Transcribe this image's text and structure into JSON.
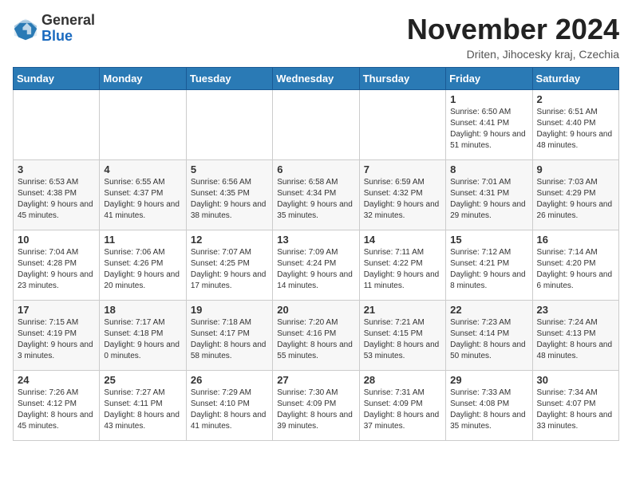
{
  "logo": {
    "line1": "General",
    "line2": "Blue"
  },
  "title": "November 2024",
  "subtitle": "Driten, Jihocesky kraj, Czechia",
  "days_of_week": [
    "Sunday",
    "Monday",
    "Tuesday",
    "Wednesday",
    "Thursday",
    "Friday",
    "Saturday"
  ],
  "weeks": [
    [
      {
        "day": "",
        "info": ""
      },
      {
        "day": "",
        "info": ""
      },
      {
        "day": "",
        "info": ""
      },
      {
        "day": "",
        "info": ""
      },
      {
        "day": "",
        "info": ""
      },
      {
        "day": "1",
        "info": "Sunrise: 6:50 AM\nSunset: 4:41 PM\nDaylight: 9 hours and 51 minutes."
      },
      {
        "day": "2",
        "info": "Sunrise: 6:51 AM\nSunset: 4:40 PM\nDaylight: 9 hours and 48 minutes."
      }
    ],
    [
      {
        "day": "3",
        "info": "Sunrise: 6:53 AM\nSunset: 4:38 PM\nDaylight: 9 hours and 45 minutes."
      },
      {
        "day": "4",
        "info": "Sunrise: 6:55 AM\nSunset: 4:37 PM\nDaylight: 9 hours and 41 minutes."
      },
      {
        "day": "5",
        "info": "Sunrise: 6:56 AM\nSunset: 4:35 PM\nDaylight: 9 hours and 38 minutes."
      },
      {
        "day": "6",
        "info": "Sunrise: 6:58 AM\nSunset: 4:34 PM\nDaylight: 9 hours and 35 minutes."
      },
      {
        "day": "7",
        "info": "Sunrise: 6:59 AM\nSunset: 4:32 PM\nDaylight: 9 hours and 32 minutes."
      },
      {
        "day": "8",
        "info": "Sunrise: 7:01 AM\nSunset: 4:31 PM\nDaylight: 9 hours and 29 minutes."
      },
      {
        "day": "9",
        "info": "Sunrise: 7:03 AM\nSunset: 4:29 PM\nDaylight: 9 hours and 26 minutes."
      }
    ],
    [
      {
        "day": "10",
        "info": "Sunrise: 7:04 AM\nSunset: 4:28 PM\nDaylight: 9 hours and 23 minutes."
      },
      {
        "day": "11",
        "info": "Sunrise: 7:06 AM\nSunset: 4:26 PM\nDaylight: 9 hours and 20 minutes."
      },
      {
        "day": "12",
        "info": "Sunrise: 7:07 AM\nSunset: 4:25 PM\nDaylight: 9 hours and 17 minutes."
      },
      {
        "day": "13",
        "info": "Sunrise: 7:09 AM\nSunset: 4:24 PM\nDaylight: 9 hours and 14 minutes."
      },
      {
        "day": "14",
        "info": "Sunrise: 7:11 AM\nSunset: 4:22 PM\nDaylight: 9 hours and 11 minutes."
      },
      {
        "day": "15",
        "info": "Sunrise: 7:12 AM\nSunset: 4:21 PM\nDaylight: 9 hours and 8 minutes."
      },
      {
        "day": "16",
        "info": "Sunrise: 7:14 AM\nSunset: 4:20 PM\nDaylight: 9 hours and 6 minutes."
      }
    ],
    [
      {
        "day": "17",
        "info": "Sunrise: 7:15 AM\nSunset: 4:19 PM\nDaylight: 9 hours and 3 minutes."
      },
      {
        "day": "18",
        "info": "Sunrise: 7:17 AM\nSunset: 4:18 PM\nDaylight: 9 hours and 0 minutes."
      },
      {
        "day": "19",
        "info": "Sunrise: 7:18 AM\nSunset: 4:17 PM\nDaylight: 8 hours and 58 minutes."
      },
      {
        "day": "20",
        "info": "Sunrise: 7:20 AM\nSunset: 4:16 PM\nDaylight: 8 hours and 55 minutes."
      },
      {
        "day": "21",
        "info": "Sunrise: 7:21 AM\nSunset: 4:15 PM\nDaylight: 8 hours and 53 minutes."
      },
      {
        "day": "22",
        "info": "Sunrise: 7:23 AM\nSunset: 4:14 PM\nDaylight: 8 hours and 50 minutes."
      },
      {
        "day": "23",
        "info": "Sunrise: 7:24 AM\nSunset: 4:13 PM\nDaylight: 8 hours and 48 minutes."
      }
    ],
    [
      {
        "day": "24",
        "info": "Sunrise: 7:26 AM\nSunset: 4:12 PM\nDaylight: 8 hours and 45 minutes."
      },
      {
        "day": "25",
        "info": "Sunrise: 7:27 AM\nSunset: 4:11 PM\nDaylight: 8 hours and 43 minutes."
      },
      {
        "day": "26",
        "info": "Sunrise: 7:29 AM\nSunset: 4:10 PM\nDaylight: 8 hours and 41 minutes."
      },
      {
        "day": "27",
        "info": "Sunrise: 7:30 AM\nSunset: 4:09 PM\nDaylight: 8 hours and 39 minutes."
      },
      {
        "day": "28",
        "info": "Sunrise: 7:31 AM\nSunset: 4:09 PM\nDaylight: 8 hours and 37 minutes."
      },
      {
        "day": "29",
        "info": "Sunrise: 7:33 AM\nSunset: 4:08 PM\nDaylight: 8 hours and 35 minutes."
      },
      {
        "day": "30",
        "info": "Sunrise: 7:34 AM\nSunset: 4:07 PM\nDaylight: 8 hours and 33 minutes."
      }
    ]
  ]
}
